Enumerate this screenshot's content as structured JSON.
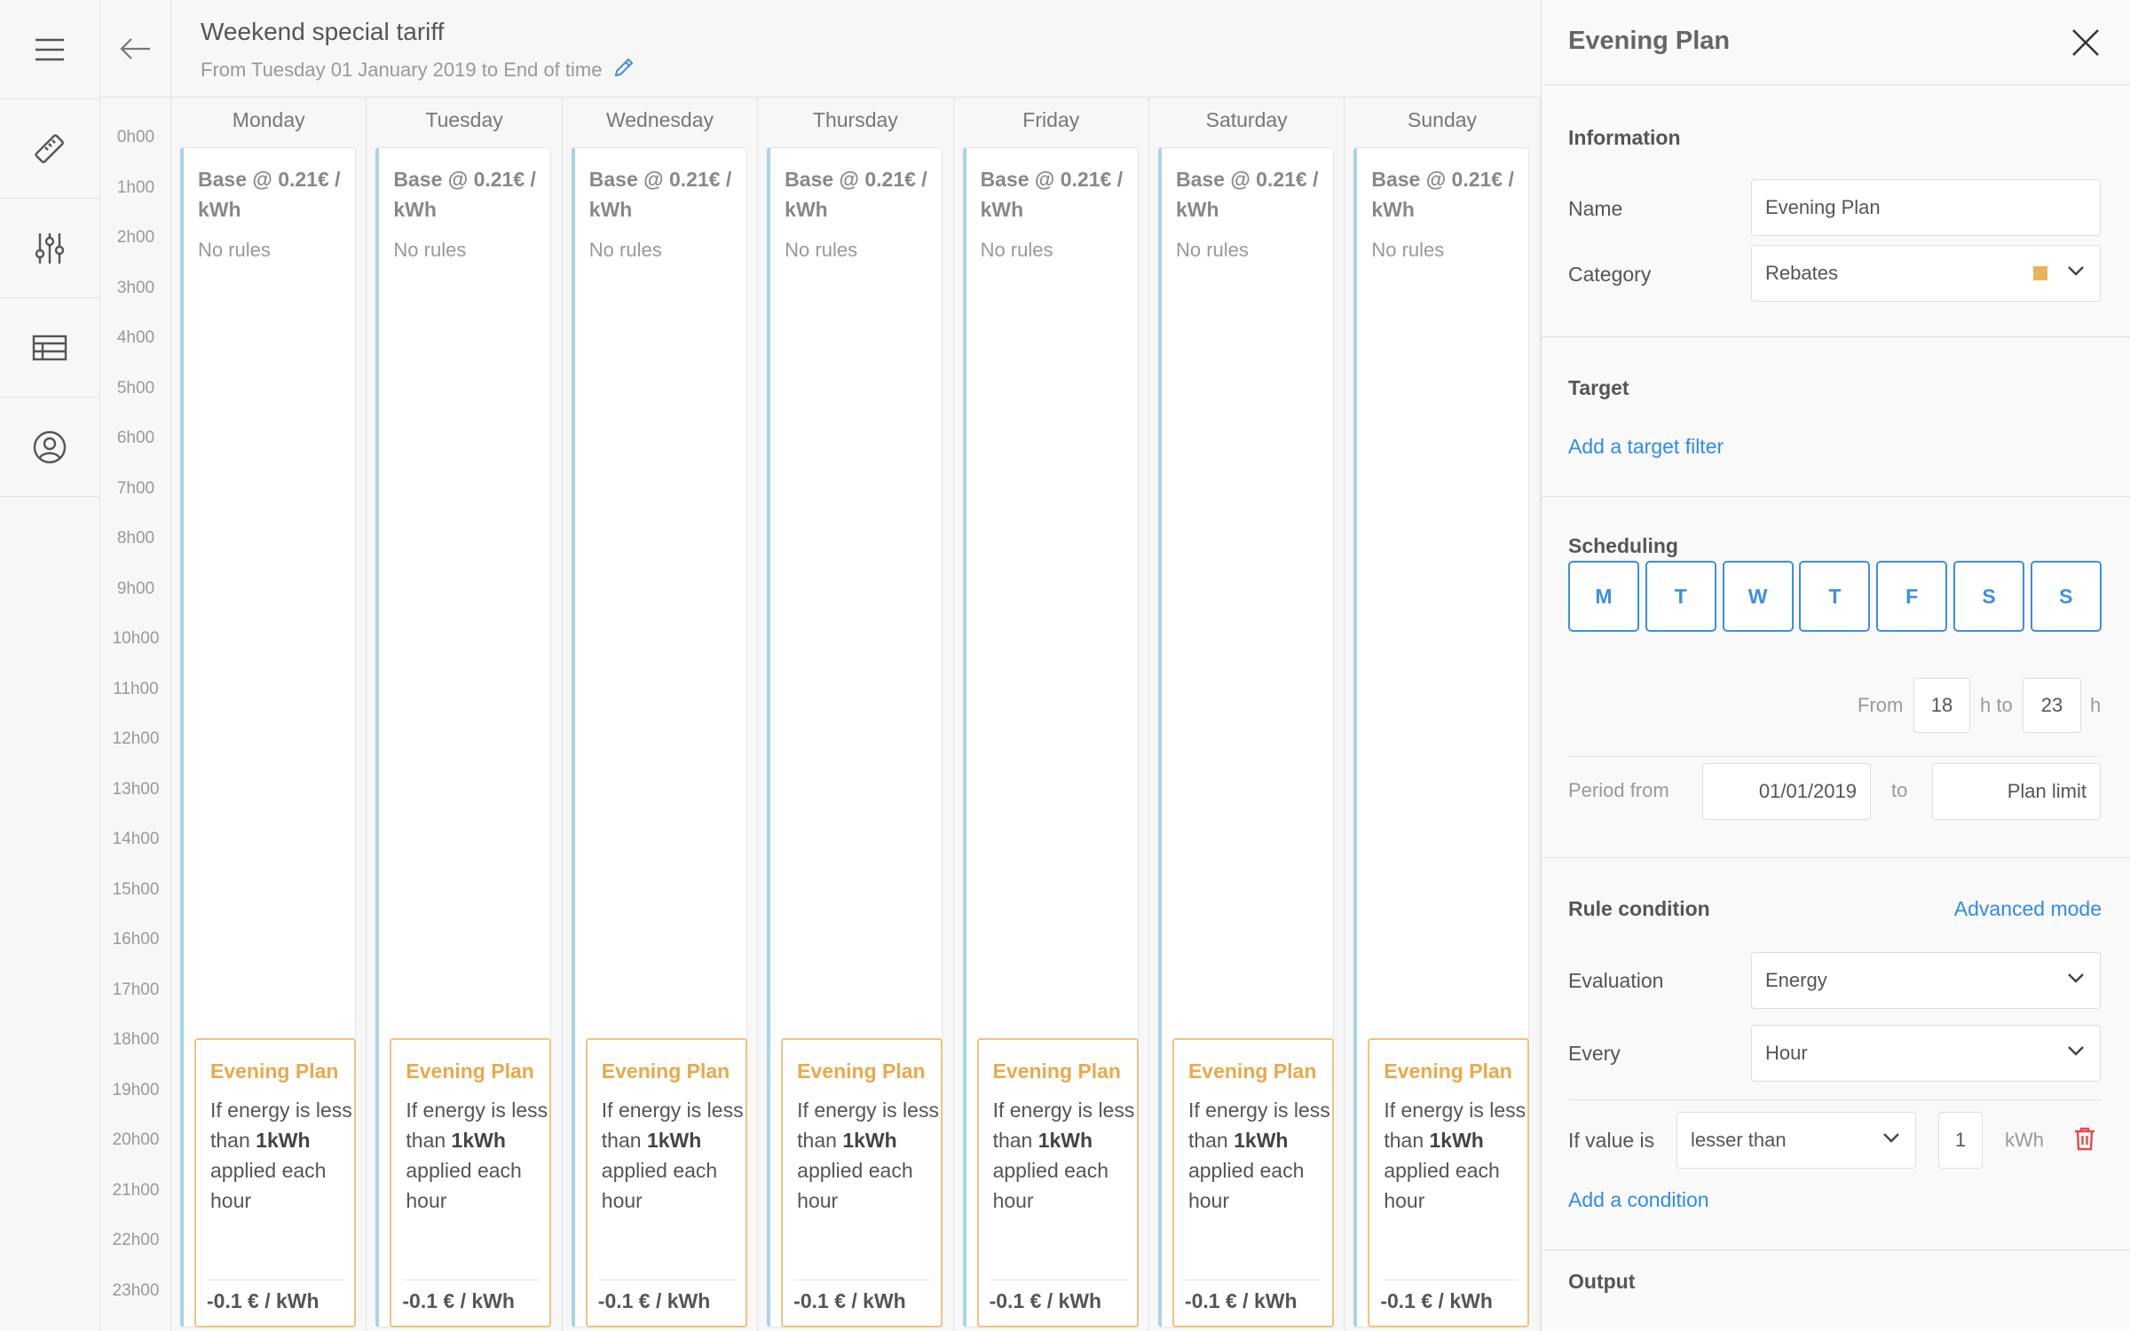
{
  "header": {
    "title": "Weekend special tariff",
    "subtitle": "From Tuesday 01 January 2019 to End of time"
  },
  "rail": {
    "icons": [
      "menu-icon",
      "ruler-icon",
      "sliders-icon",
      "table-icon",
      "user-icon"
    ]
  },
  "calendar": {
    "hours": [
      "0h00",
      "1h00",
      "2h00",
      "3h00",
      "4h00",
      "5h00",
      "6h00",
      "7h00",
      "8h00",
      "9h00",
      "10h00",
      "11h00",
      "12h00",
      "13h00",
      "14h00",
      "15h00",
      "16h00",
      "17h00",
      "18h00",
      "19h00",
      "20h00",
      "21h00",
      "22h00",
      "23h00"
    ],
    "days": [
      {
        "name": "Monday"
      },
      {
        "name": "Tuesday"
      },
      {
        "name": "Wednesday"
      },
      {
        "name": "Thursday"
      },
      {
        "name": "Friday"
      },
      {
        "name": "Saturday"
      },
      {
        "name": "Sunday"
      }
    ],
    "base": {
      "title": "Base @ 0.21€ / kWh",
      "rules": "No rules"
    },
    "plan": {
      "title": "Evening Plan",
      "text_pre": "If energy is less than ",
      "text_bold": "1kWh",
      "text_post": " applied each hour",
      "price": "-0.1 € / kWh"
    }
  },
  "panel": {
    "title": "Evening Plan",
    "information": {
      "title": "Information",
      "name_label": "Name",
      "name_value": "Evening Plan",
      "category_label": "Category",
      "category_value": "Rebates",
      "category_color": "#e8b45a"
    },
    "target": {
      "title": "Target",
      "add_link": "Add a target filter"
    },
    "scheduling": {
      "title": "Scheduling",
      "days": [
        "M",
        "T",
        "W",
        "T",
        "F",
        "S",
        "S"
      ],
      "from_label": "From",
      "from_value": "18",
      "to_label": "h to",
      "to_value": "23",
      "h_label": "h",
      "period_label": "Period from",
      "period_from": "01/01/2019",
      "period_to_label": "to",
      "period_to": "Plan limit"
    },
    "rule": {
      "title": "Rule condition",
      "advanced": "Advanced mode",
      "evaluation_label": "Evaluation",
      "evaluation_value": "Energy",
      "every_label": "Every",
      "every_value": "Hour",
      "if_label": "If value is",
      "comparator": "lesser than",
      "value": "1",
      "unit": "kWh",
      "add_condition": "Add a condition"
    },
    "output": {
      "title": "Output"
    }
  }
}
